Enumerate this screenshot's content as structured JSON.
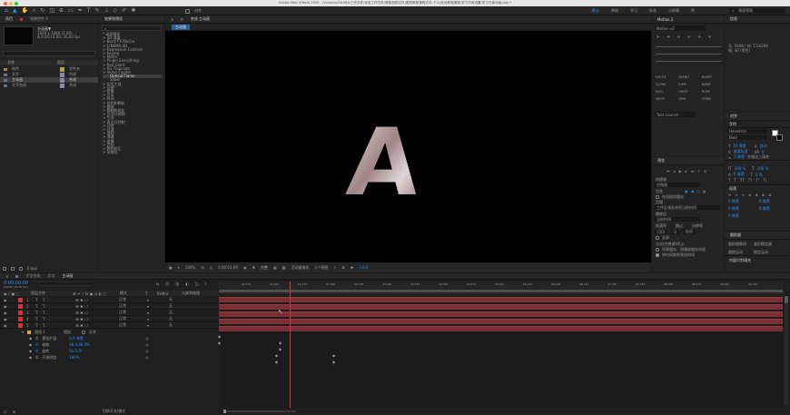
{
  "title_bar": {
    "text": "Adobe After Effects 2020 - /Volumes/5A08大工作文件/优设工作文件/教程视频文件/图层教程课程文件-个人/优设教程课程/学习书库设置/学习书库动画.aep *"
  },
  "toolbar": {
    "snap_label": "对齐",
    "workspaces": [
      "默认",
      "审阅",
      "学习",
      "标准",
      "小屏幕",
      "库"
    ],
    "search_placeholder": "搜索帮助"
  },
  "project_panel": {
    "tabs": [
      "项目",
      "效果控件 A"
    ],
    "comp_name": "主动画▼",
    "comp_info": [
      "1920 x 1080 (1.00)",
      "Δ 0:00:10:00, 30.00 fps"
    ],
    "search_placeholder": "",
    "columns": [
      "名称",
      "类型"
    ],
    "items": [
      {
        "name": "纯色",
        "type": "文件夹"
      },
      {
        "name": "文字",
        "type": "合成"
      },
      {
        "name": "主动画",
        "type": "合成"
      },
      {
        "name": "文字合成",
        "type": "合成"
      }
    ],
    "bpc": "8 bpc"
  },
  "effects_panel": {
    "tab": "效果和预设",
    "items": [
      "* 动画预设",
      "> 3D 通道",
      "> Boris FX Mocha",
      "> CINEMA 4D",
      "> Expression Controls",
      "> Keying",
      "> Matte",
      "> Plugin Everything",
      "> Red Giant",
      "> RG Trapcode",
      "> Video Copilot",
      "Optical Flares",
      "Saber",
      "> 实用工具",
      "> 扭曲",
      "> 抠像",
      "> 文本",
      "> 时间",
      "> 杂色和颗粒",
      "> 模拟",
      "> 模糊和锐化",
      "> 沉浸式视频",
      "> 生成",
      "> 表达式控制",
      "> 过时",
      "> 过渡",
      "> 透视",
      "> 通道",
      "> 遮罩",
      "> 音频",
      "> 颜色校正",
      "> 风格化"
    ]
  },
  "comp_viewer": {
    "tab_label": "合成 主动画",
    "breadcrumb": "主动画",
    "letter": "A",
    "footer": {
      "zoom": "100%",
      "timecode": "0:00:01:09",
      "quality": "完整",
      "camera": "活动摄像机",
      "views": "1个视图",
      "offset": "+0.0"
    }
  },
  "motion2_panel": {
    "title": "Motion 2",
    "select": "Motion v2",
    "buttons": [
      "EXCITE",
      "BLEND",
      "BURST",
      "CLONE",
      "JUMP",
      "NAME",
      "NULL",
      "ORBIT",
      "ROPE",
      "WARP",
      "SPIN",
      "STARE"
    ],
    "task": "Task Launch"
  },
  "info_panel": {
    "title": "信息",
    "lines": [
      "无: 5048 / 帧: 113/200",
      "帧: 40 (黑色)"
    ]
  },
  "align_panel": {
    "title": "对齐"
  },
  "char_panel": {
    "title": "字符",
    "font": "Helvetica",
    "style": "Bold",
    "size": "10 像素",
    "leading": "自动",
    "metrics": "度量标准",
    "tracking": "0",
    "stroke": "3 像素",
    "fill_over": "在描边上填充",
    "scale_v": "100 %",
    "scale_h": "100 %",
    "baseline": "0 像素",
    "tsume": "0 %"
  },
  "paragraph_panel": {
    "title": "段落",
    "values": [
      "0 像素",
      "0 像素",
      "0 像素",
      "0 像素",
      "0 像素"
    ]
  },
  "preview_panel": {
    "title": "预览",
    "shortcut_label": "快捷键",
    "shortcut": "空格键",
    "include_label": "包含",
    "cache_label": "在回放前缓存",
    "range_label": "范围",
    "range": "工作区域延伸到当前时间",
    "play_from_label": "播放自",
    "play_from": "当前时间",
    "frame_rate_label": "帧速率",
    "skip_label": "跳过",
    "resolution_label": "分辨率",
    "frame_rate": "(30)",
    "skip": "0",
    "resolution": "自动",
    "fullscreen": "全屏",
    "stop_label": "点击(空格键)停止:",
    "opt1": "如果缓存，则播放缓存的帧",
    "opt2": "将时间移到预览时间"
  },
  "tracker_panel": {
    "title": "跟踪器",
    "items": [
      "跟踪摄像机",
      "变形稳定器",
      "跟踪运动",
      "稳定运动"
    ]
  },
  "content_panel": {
    "title": "内容识别填充"
  },
  "timeline": {
    "tabs": [
      "文字合成",
      "文字",
      "主动画"
    ],
    "timecode": "0:00:00:00",
    "fps_note": "00000 (30.00 fps)",
    "columns": [
      "图层名称",
      "模式",
      "T",
      "TrkMat",
      "父级和链接"
    ],
    "layers": [
      {
        "num": "1",
        "name": "T"
      },
      {
        "num": "2",
        "name": "T"
      },
      {
        "num": "3",
        "name": "T"
      },
      {
        "num": "4",
        "name": "T"
      },
      {
        "num": "5",
        "name": "T"
      }
    ],
    "mode": "正常",
    "parent": "无",
    "sublabel": "路径 1",
    "sub_mode": "相加",
    "sub_invert": "反转",
    "props": [
      {
        "name": "蒙版扩展",
        "value": "0.0 像素"
      },
      {
        "name": "缩放",
        "value": "68.0,68.0%"
      },
      {
        "name": "旋转",
        "value": "0x-5.0°"
      },
      {
        "name": "不透明度",
        "value": "100%"
      }
    ],
    "ruler": [
      "00:15f",
      "01:00f",
      "01:15f",
      "02:00f",
      "02:15f",
      "03:00f",
      "03:15f",
      "04:00f",
      "04:15f",
      "05:00f",
      "05:15f",
      "06:00f",
      "06:15f",
      "07:00f",
      "07:15f",
      "08:00f",
      "08:15f",
      "09:00f",
      "09:15f"
    ],
    "switch_label": "切换开关/模式"
  }
}
